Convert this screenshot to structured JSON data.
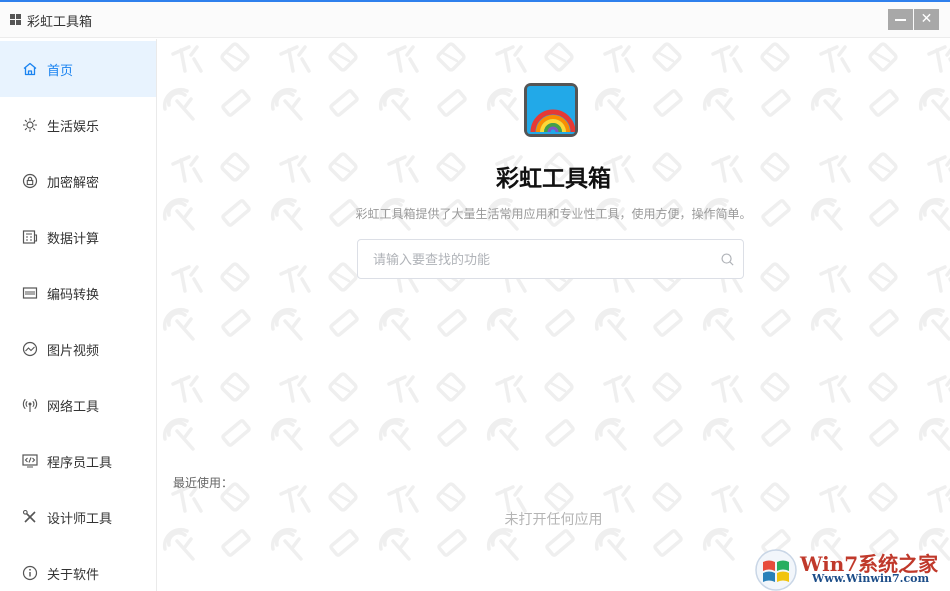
{
  "window": {
    "title": "彩虹工具箱",
    "minimize_icon": "minimize-icon",
    "close_glyph": "✕"
  },
  "sidebar": {
    "active_color": "#1a83f0",
    "items": [
      {
        "label": "首页",
        "icon": "home-icon",
        "active": true
      },
      {
        "label": "生活娱乐",
        "icon": "lifestyle-icon"
      },
      {
        "label": "加密解密",
        "icon": "lock-icon"
      },
      {
        "label": "数据计算",
        "icon": "calculator-icon"
      },
      {
        "label": "编码转换",
        "icon": "encoding-icon"
      },
      {
        "label": "图片视频",
        "icon": "image-icon"
      },
      {
        "label": "网络工具",
        "icon": "network-icon"
      },
      {
        "label": "程序员工具",
        "icon": "code-icon"
      },
      {
        "label": "设计师工具",
        "icon": "design-tools-icon"
      },
      {
        "label": "关于软件",
        "icon": "info-icon"
      }
    ]
  },
  "main": {
    "app_name": "彩虹工具箱",
    "description": "彩虹工具箱提供了大量生活常用应用和专业性工具，使用方便，操作简单。",
    "search": {
      "placeholder": "请输入要查找的功能",
      "value": ""
    },
    "recent_label": "最近使用：",
    "empty_text": "未打开任何应用"
  },
  "badge": {
    "title": "Win7系统之家",
    "url": "Www.Winwin7.com"
  }
}
